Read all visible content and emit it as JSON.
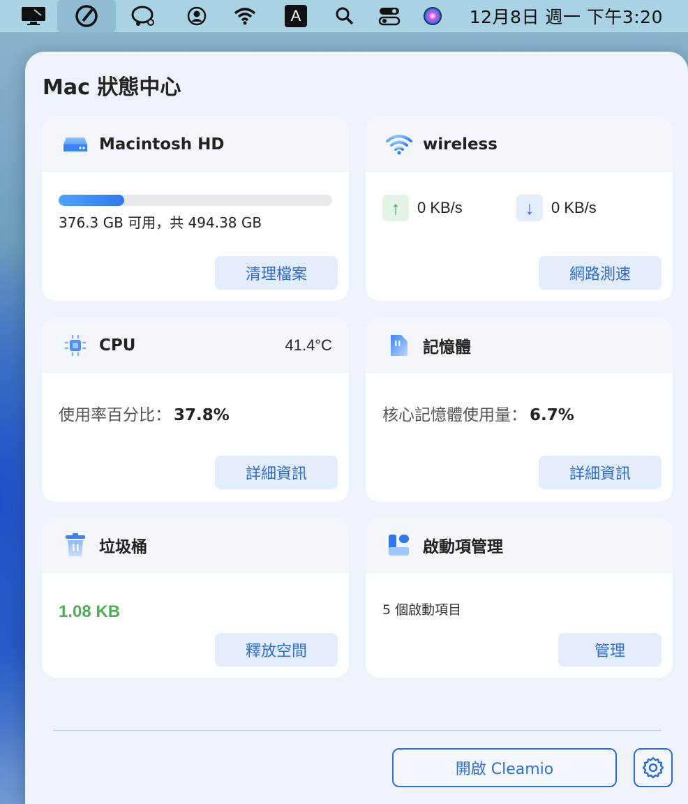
{
  "menubar": {
    "clock": "12月8日 週一 下午3:20",
    "icons": [
      "display-icon",
      "cleamio-icon",
      "chat-icon",
      "user-icon",
      "wifi-icon",
      "input-method-icon",
      "search-icon",
      "control-center-icon",
      "siri-icon"
    ],
    "input_method_label": "A"
  },
  "panel": {
    "title": "Mac 狀態中心"
  },
  "disk": {
    "name": "Macintosh HD",
    "usage_text": "376.3 GB 可用，共 494.38 GB",
    "used_fraction": 0.24,
    "button": "清理檔案"
  },
  "network": {
    "name": "wireless",
    "upload": "0 KB/s",
    "download": "0 KB/s",
    "button": "網路測速"
  },
  "cpu": {
    "name": "CPU",
    "temperature": "41.4°C",
    "usage_label": "使用率百分比：",
    "usage_value": "37.8%",
    "button": "詳細資訊"
  },
  "memory": {
    "name": "記憶體",
    "usage_label": "核心記憶體使用量：",
    "usage_value": "6.7%",
    "button": "詳細資訊"
  },
  "trash": {
    "name": "垃圾桶",
    "size": "1.08  KB",
    "button": "釋放空間"
  },
  "startup": {
    "name": "啟動項管理",
    "count_text": "5 個啟動項目",
    "button": "管理"
  },
  "footer": {
    "open_button": "開啟 Cleamio"
  },
  "colors": {
    "accent": "#2e6cd6",
    "trash_size": "#4caf50",
    "upload_arrow": "#3aa757",
    "download_arrow": "#2e6cd6"
  }
}
